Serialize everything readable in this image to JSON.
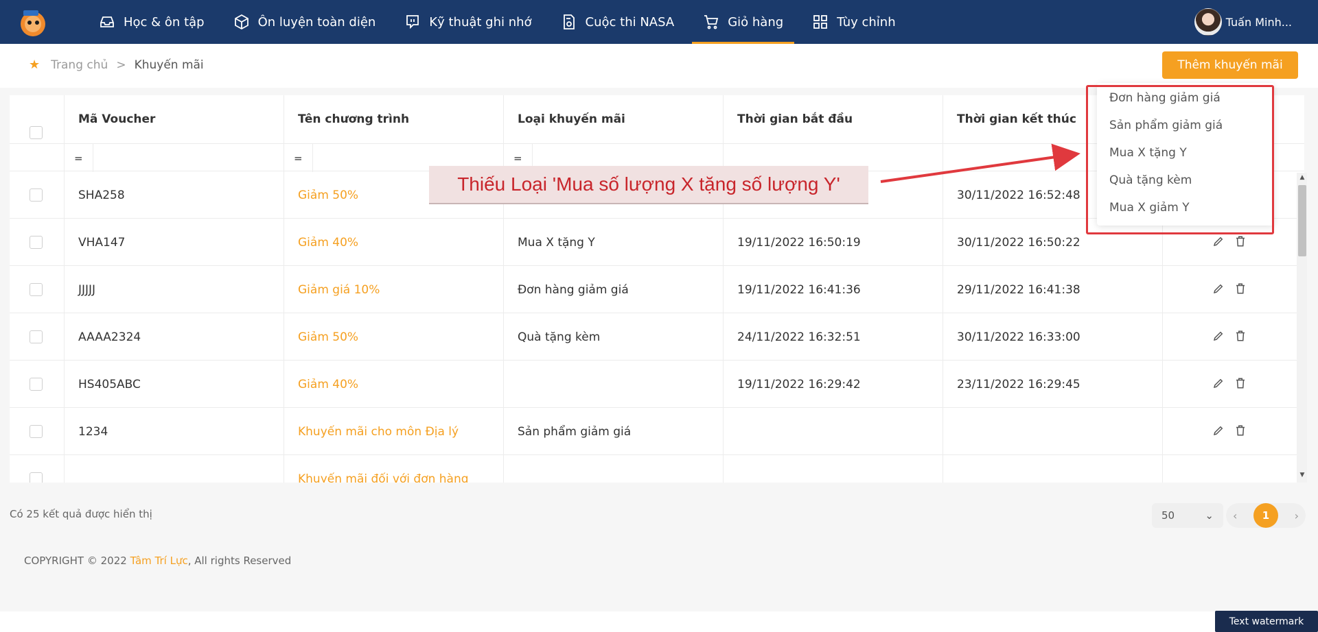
{
  "nav": {
    "items": [
      {
        "label": "Học & ôn tập",
        "icon": "inbox-icon"
      },
      {
        "label": "Ôn luyện toàn diện",
        "icon": "cube-icon"
      },
      {
        "label": "Kỹ thuật ghi nhớ",
        "icon": "chat-bubble-icon"
      },
      {
        "label": "Cuộc thi NASA",
        "icon": "document-award-icon"
      },
      {
        "label": "Giỏ hàng",
        "icon": "cart-icon"
      },
      {
        "label": "Tùy chỉnh",
        "icon": "grid-icon"
      }
    ],
    "active_index": 4,
    "user_name": "Tuấn Minh..."
  },
  "breadcrumb": {
    "home": "Trang chủ",
    "separator": ">",
    "current": "Khuyến mãi"
  },
  "add_button": "Thêm khuyến mãi",
  "table": {
    "headers": [
      "Mã Voucher",
      "Tên chương trình",
      "Loại khuyến mãi",
      "Thời gian bắt đầu",
      "Thời gian kết thúc"
    ],
    "filter_operator": "=",
    "rows": [
      {
        "code": "SHA258",
        "name": "Giảm 50%",
        "type": "",
        "start": "",
        "end": "30/11/2022 16:52:48"
      },
      {
        "code": "VHA147",
        "name": "Giảm 40%",
        "type": "Mua X tặng Y",
        "start": "19/11/2022 16:50:19",
        "end": "30/11/2022 16:50:22"
      },
      {
        "code": "JJJJJ",
        "name": "Giảm giá 10%",
        "type": "Đơn hàng giảm giá",
        "start": "19/11/2022 16:41:36",
        "end": "29/11/2022 16:41:38"
      },
      {
        "code": "AAAA2324",
        "name": "Giảm 50%",
        "type": "Quà tặng kèm",
        "start": "24/11/2022 16:32:51",
        "end": "30/11/2022 16:33:00"
      },
      {
        "code": "HS405ABC",
        "name": "Giảm 40%",
        "type": "",
        "start": "19/11/2022 16:29:42",
        "end": "23/11/2022 16:29:45"
      },
      {
        "code": "1234",
        "name": "Khuyến mãi cho môn Địa lý",
        "type": "Sản phẩm giảm giá",
        "start": "",
        "end": ""
      },
      {
        "code": "",
        "name": "Khuyến mãi đối với đơn hàng",
        "type": "",
        "start": "",
        "end": ""
      }
    ]
  },
  "dropdown": {
    "options": [
      "Đơn hàng giảm giá",
      "Sản phẩm giảm giá",
      "Mua X tặng Y",
      "Quà tặng kèm",
      "Mua X giảm Y"
    ]
  },
  "annotation": "Thiếu Loại 'Mua số lượng X tặng số lượng Y'",
  "result_count": "Có 25 kết quả được hiển thị",
  "page_size": "50",
  "current_page": "1",
  "footer": {
    "prefix": "COPYRIGHT © 2022 ",
    "brand": "Tâm Trí Lực",
    "suffix": ", All rights Reserved"
  },
  "watermark": "Text watermark",
  "colors": {
    "nav_bg": "#1b3a6b",
    "accent": "#f5a021",
    "annotation_red": "#e0393e"
  }
}
